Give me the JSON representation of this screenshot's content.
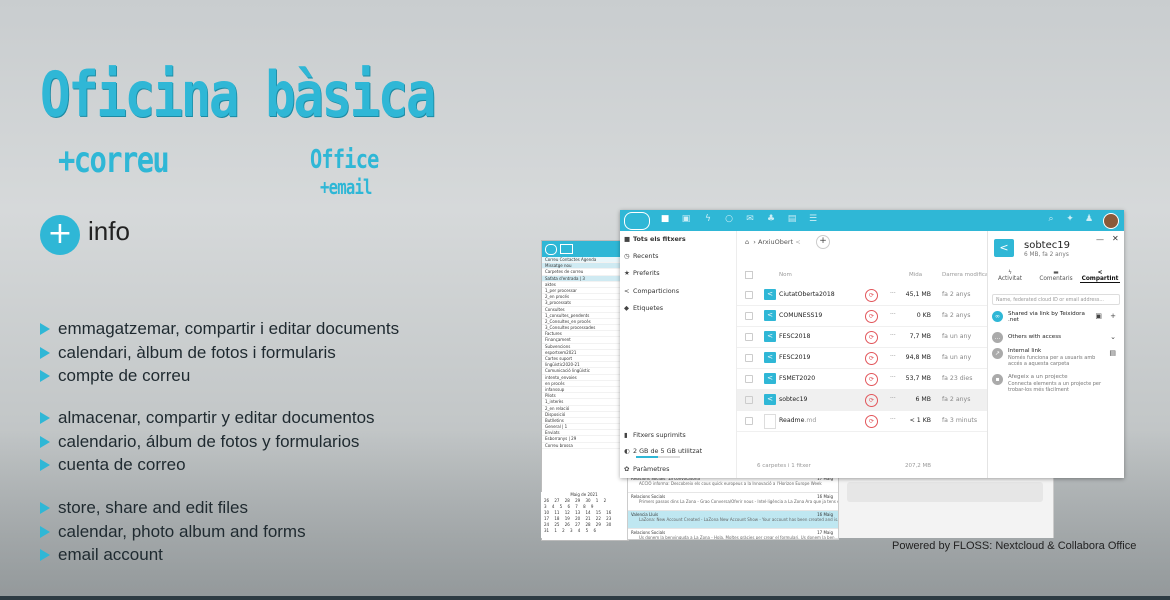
{
  "poster": {
    "title": "Oficina bàsica",
    "subtitle": "+correu",
    "office_logo_1": "Office",
    "office_logo_2": "+email",
    "info_plus": "+",
    "info_label": "info",
    "bullets_ca": [
      "emmagatzemar, compartir i editar documents",
      "calendari, àlbum de fotos i formularis",
      "compte de correu"
    ],
    "bullets_es": [
      "almacenar, compartir y editar documentos",
      "calendario, álbum de fotos y formularios",
      "cuenta de correo"
    ],
    "bullets_en": [
      "store, share and edit files",
      "calendar, photo album and forms",
      "email account"
    ],
    "powered_by": "Powered by FLOSS: Nextcloud & Collabora Office",
    "accent_color": "#2fb7d6"
  },
  "mail_app": {
    "tabs": "Correu   Contactes   Agenda",
    "new_message": "Missatge nou",
    "folders": [
      "Carpetes de correu",
      "Safata d'entrada | 3",
      "aktes",
      "1_per processar",
      "2_en procés",
      "3_processats",
      "Consultes",
      "1_consultes_pendents",
      "2_Consultes_en procés",
      "3_Consultes processades",
      "Factures",
      "Finançament",
      "Subvencions",
      "esportsem2021",
      "Cartes suport",
      "lingüístic2020-21",
      "Comunicació lingüístic",
      "intento_envoies",
      "en procés",
      "infanssup",
      "Pilots",
      "1_interès",
      "2_en relació",
      "Disposició",
      "Butlletins",
      "General | 1",
      "Enviats",
      "Esborranys | 29",
      "Correu brossa"
    ],
    "calendar_header": "Maig de 2021",
    "calendar_rows": [
      "26 27 28 29 30 1 2",
      "3 4 5 6 7 8 9",
      "10 11 12 13 14 15 16",
      "17 18 19 20 21 22 23",
      "24 25 26 27 28 29 30",
      "31 1 2 3 4 5 6"
    ],
    "messages": [
      {
        "from": "Relacions Socials: 1a convocatòria",
        "subject": "ACCIÓ informa: Descobreix els cous quick europeus a la Innovació a l'Horizon Europe Week",
        "date": "17 Maig"
      },
      {
        "from": "Relacions Socials",
        "subject": "Primers passos dins La Zona - Grao Conversa/Oferir nous - Intel·ligència a La Zona Ara que ja tens el...",
        "date": "16 Maig"
      },
      {
        "from": "Valencia Lluís",
        "subject": "LaZona: New Account Created - LaZona New Account Show - Your account has been created and is...",
        "date": "16 Maig"
      },
      {
        "from": "Relacions Socials",
        "subject": "Us donem la benvinguda a La Zona - Hola, Moltes gràcies per crear el formulari. Us donem la ben...",
        "date": "17 Maig"
      }
    ]
  },
  "nextcloud": {
    "nav": [
      {
        "icon": "folder-icon",
        "label": "Tots els fitxers",
        "active": true
      },
      {
        "icon": "clock-icon",
        "label": "Recents"
      },
      {
        "icon": "star-icon",
        "label": "Preferits"
      },
      {
        "icon": "share-icon",
        "label": "Comparticions"
      },
      {
        "icon": "tag-icon",
        "label": "Etiquetes"
      }
    ],
    "nav_bottom": {
      "deleted": "Fitxers suprimits",
      "quota": "2 GB de 5 GB utilitzat",
      "settings": "Paràmetres"
    },
    "breadcrumb": {
      "home": "⌂",
      "folder": "ArxiuObert"
    },
    "table_headers": {
      "name": "Nom",
      "size": "Mida",
      "modified": "Darrera modificació"
    },
    "files": [
      {
        "name": "CiutatOberta2018",
        "size": "45,1 MB",
        "date": "fa 2 anys",
        "type": "folder"
      },
      {
        "name": "COMUNESS19",
        "size": "0 KB",
        "date": "fa 2 anys",
        "type": "folder"
      },
      {
        "name": "FESC2018",
        "size": "7,7 MB",
        "date": "fa un any",
        "type": "folder"
      },
      {
        "name": "FESC2019",
        "size": "94,8 MB",
        "date": "fa un any",
        "type": "folder"
      },
      {
        "name": "FSMET2020",
        "size": "53,7 MB",
        "date": "fa 23 dies",
        "type": "folder"
      },
      {
        "name": "sobtec19",
        "size": "6 MB",
        "date": "fa 2 anys",
        "type": "folder"
      },
      {
        "name": "Readme",
        "ext": ".md",
        "size": "< 1 KB",
        "date": "fa 3 minuts",
        "type": "file"
      }
    ],
    "summary": "6 carpetes i 1 fitxer",
    "summary_size": "207,2 MB",
    "sidebar": {
      "name": "sobtec19",
      "meta": "6 MB, fa 2 anys",
      "tabs": [
        "Activitat",
        "Comentaris",
        "Compartint"
      ],
      "share_input_placeholder": "Name, federated cloud ID or email address...",
      "shared_via": "Shared via link by Teixidora .net",
      "others_access": "Others with access",
      "internal_link": "Internal link",
      "internal_link_desc": "Només funciona per a usuaris amb accés a aquesta carpeta",
      "project": "Afegeix a un projecte",
      "project_desc": "Connecta elements a un projecte per trobar-los més fàcilment"
    }
  }
}
